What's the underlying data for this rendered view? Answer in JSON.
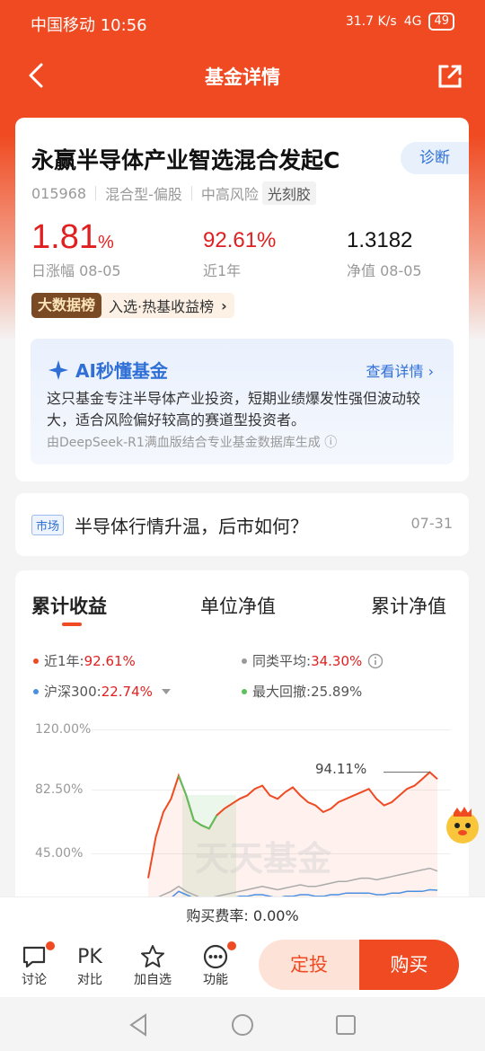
{
  "status_bar": {
    "carrier_time": "中国移动 10:56",
    "net_speed": "31.7 K/s",
    "network": "4G",
    "battery": "49"
  },
  "nav": {
    "title": "基金详情"
  },
  "fund": {
    "name": "永赢半导体产业智选混合发起C",
    "code": "015968",
    "type": "混合型-偏股",
    "risk": "中高风险",
    "concept": "光刻胶",
    "diagnose_label": "诊断",
    "daily_change_value": "1.81",
    "daily_change_unit": "%",
    "daily_change_label": "日涨幅 08-05",
    "one_year_value": "92.61%",
    "one_year_label": "近1年",
    "nav_value": "1.3182",
    "nav_label": "净值 08-05",
    "rank_tag": "大数据榜",
    "rank_text": "入选·热基收益榜",
    "rank_chevron": "›"
  },
  "ai": {
    "title": "AI秒懂基金",
    "more_label": "查看详情 ›",
    "summary": "这只基金专注半导体产业投资，短期业绩爆发性强但波动较大，适合风险偏好较高的赛道型投资者。",
    "footnote": "由DeepSeek-R1满血版结合专业基金数据库生成 ⓘ"
  },
  "news": {
    "tag": "市场",
    "title": "半导体行情升温，后市如何？",
    "date": "07-31"
  },
  "chart_section": {
    "tabs": [
      "累计收益",
      "单位净值",
      "累计净值"
    ],
    "active_tab": 0,
    "legend": {
      "fund_label": "近1年:",
      "fund_value": "92.61%",
      "peer_label": "同类平均:",
      "peer_value": "34.30%",
      "index_label": "沪深300:",
      "index_value": "22.74%",
      "drawdown_label": "最大回撤:",
      "drawdown_value": "25.89%"
    },
    "watermark": "天天基金",
    "peak_label": "94.11%"
  },
  "chart_data": {
    "type": "line",
    "ylim": [
      45,
      120
    ],
    "yticks": [
      "120.00%",
      "82.50%",
      "45.00%"
    ],
    "series": [
      {
        "name": "近1年",
        "color": "#ef4a21",
        "values": [
          30,
          55,
          70,
          78,
          92,
          80,
          65,
          62,
          60,
          68,
          72,
          75,
          78,
          80,
          84,
          86,
          80,
          78,
          82,
          85,
          80,
          76,
          74,
          70,
          72,
          76,
          78,
          80,
          82,
          84,
          78,
          74,
          76,
          80,
          84,
          86,
          90,
          94.11,
          90
        ]
      },
      {
        "name": "同类平均",
        "color": "#aaaaaa",
        "values": [
          10,
          15,
          20,
          22,
          25,
          22,
          20,
          18,
          17,
          19,
          20,
          21,
          22,
          23,
          24,
          25,
          24,
          23,
          24,
          25,
          26,
          25,
          25,
          26,
          27,
          28,
          28,
          29,
          30,
          30,
          29,
          30,
          31,
          32,
          33,
          34,
          35,
          36,
          34.3
        ]
      },
      {
        "name": "沪深300",
        "color": "#4a90e2",
        "values": [
          5,
          10,
          15,
          18,
          22,
          20,
          18,
          16,
          15,
          16,
          17,
          18,
          19,
          19,
          20,
          20,
          19,
          18,
          19,
          19,
          20,
          20,
          19,
          19,
          20,
          20,
          21,
          21,
          21,
          21,
          20,
          20,
          21,
          21,
          22,
          22,
          22,
          23,
          22.74
        ]
      }
    ],
    "max_drawdown": "25.89%",
    "annotation": "94.11%"
  },
  "fee": {
    "label": "购买费率: 0.00%"
  },
  "bottom_bar": {
    "items": [
      {
        "label": "讨论",
        "icon": "chat-icon"
      },
      {
        "label": "对比",
        "icon_text": "PK"
      },
      {
        "label": "加自选",
        "icon": "star-icon"
      },
      {
        "label": "功能",
        "icon": "more-icon"
      }
    ],
    "dingtou_label": "定投",
    "buy_label": "购买"
  }
}
